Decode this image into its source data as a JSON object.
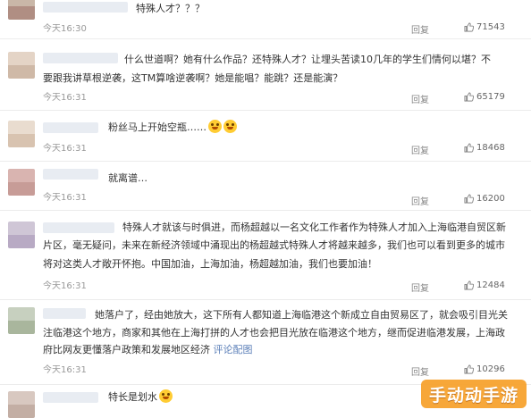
{
  "comments": [
    {
      "text_lines": [
        "特殊人才？？？"
      ],
      "time": "今天16:30",
      "reply_label": "回复",
      "likes": "71543"
    },
    {
      "text_lines": [
        "什么世道啊？她有什么作品？还特殊人才？让埋头苦读10几年的学生们情何以堪？不",
        "要跟我讲草根逆袭，这TM算啥逆袭啊？她是能唱？能跳？还是能演？"
      ],
      "time": "今天16:31",
      "reply_label": "回复",
      "likes": "65179"
    },
    {
      "text_lines": [
        "粉丝马上开始空瓶……"
      ],
      "time": "今天16:31",
      "reply_label": "回复",
      "likes": "18468",
      "emojis": [
        "sweat-smile-emoji",
        "smile-emoji"
      ]
    },
    {
      "text_lines": [
        "就离谱…"
      ],
      "time": "今天16:31",
      "reply_label": "回复",
      "likes": "16200"
    },
    {
      "text_lines": [
        "特殊人才就该与时俱进，而杨超越以一名文化工作者作为特殊人才加入上海临港自贸区新",
        "片区，毫无疑问，未来在新经济领域中涌现出的杨超越式特殊人才将越来越多，我们也可以看到更多的城市",
        "将对这类人才敞开怀抱。中国加油，上海加油，杨超越加油，我们也要加油！"
      ],
      "time": "今天16:31",
      "reply_label": "回复",
      "likes": "12484"
    },
    {
      "text_lines": [
        "她落户了，经由她放大，这下所有人都知道上海临港这个新成立自由贸易区了，就会吸引目光关",
        "注临港这个地方，商家和其他在上海打拼的人才也会把目光放在临港这个地方，继而促进临港发展，上海政",
        "府比网友更懂落户政策和发展地区经济"
      ],
      "link_label": "评论配图",
      "time": "今天16:31",
      "reply_label": "回复",
      "likes": "10296"
    },
    {
      "text_lines": [
        "特长是划水"
      ],
      "emojis": [
        "grin-emoji"
      ]
    }
  ],
  "watermark": "手动动手游",
  "colors": {
    "text": "#333333",
    "meta": "#999999",
    "link": "#5b7fb8",
    "watermark_bg": "#f6a028"
  }
}
